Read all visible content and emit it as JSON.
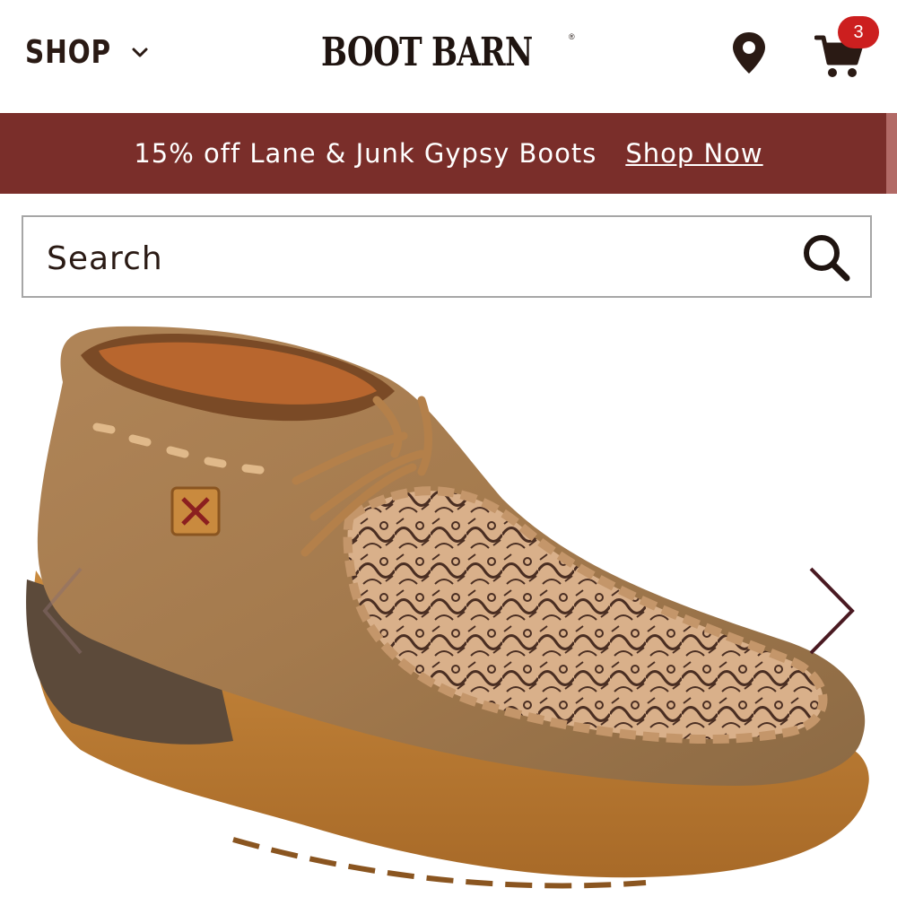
{
  "header": {
    "shop_label": "SHOP",
    "logo_text": "BOOT BARN",
    "logo_reg": "®",
    "cart_count": "3"
  },
  "promo": {
    "text": "15% off Lane & Junk Gypsy Boots",
    "link_label": "Shop Now"
  },
  "search": {
    "placeholder": "Search",
    "value": ""
  },
  "gallery": {
    "image_alt": "Brown leather chukka moccasin boot with tooled floral toe",
    "prev_icon": "chevron-left-icon",
    "next_icon": "chevron-right-icon"
  },
  "colors": {
    "brand_text": "#2a1a14",
    "promo_bg": "#7a2e2a",
    "badge": "#cc1f1f",
    "border": "#a6a6a6"
  }
}
